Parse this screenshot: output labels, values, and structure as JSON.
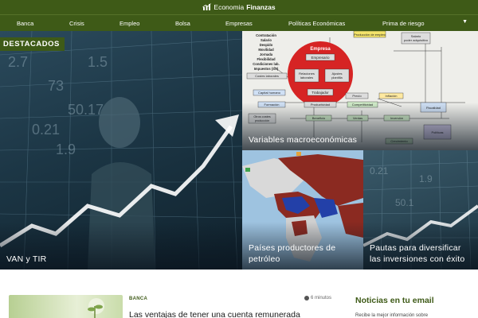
{
  "brand": {
    "part1": "Economia",
    "part2": "Finanzas"
  },
  "nav": {
    "items": [
      {
        "label": "Banca"
      },
      {
        "label": "Crisis"
      },
      {
        "label": "Empleo"
      },
      {
        "label": "Bolsa"
      },
      {
        "label": "Empresas"
      },
      {
        "label": "Políticas Económicas"
      },
      {
        "label": "Prima de riesgo"
      }
    ],
    "more_icon": "chevron-down-icon"
  },
  "featured": {
    "badge": "DESTACADOS",
    "cards": [
      {
        "title": "VAN y TIR"
      },
      {
        "title": "Variables macroeconómicas"
      },
      {
        "title": "Países productores de petróleo"
      },
      {
        "title": "Pautas para diversificar las inversiones con éxito"
      }
    ]
  },
  "diagram": {
    "labels": [
      "Contratación",
      "Salario",
      "Despido",
      "Movilidad",
      "Jornada",
      "Flexibilidad",
      "Condiciones lab.",
      "Impuestos (SS)",
      "Costes laborales",
      "Empresa",
      "Empresario",
      "Relaciones laborales",
      "Ajustes plantilla",
      "Trabajador",
      "Capital humano",
      "Formación",
      "Productividad",
      "Precio",
      "Inflación",
      "Salario poder adquisitivo",
      "Producción de empleo",
      "Otros costes producción",
      "Beneficio",
      "Inversión",
      "Ventas",
      "Competitividad",
      "Fiscalidad",
      "Crecimiento",
      "Políticas"
    ]
  },
  "article": {
    "category": "BANCA",
    "read_time": "6 minutos",
    "title": "Las ventajas de tener una cuenta remunerada"
  },
  "newsletter": {
    "heading": "Noticias en tu email",
    "text": "Recibe la mejor información sobre"
  },
  "colors": {
    "brand_green": "#3e5a17",
    "diagram_red": "#d42020"
  }
}
